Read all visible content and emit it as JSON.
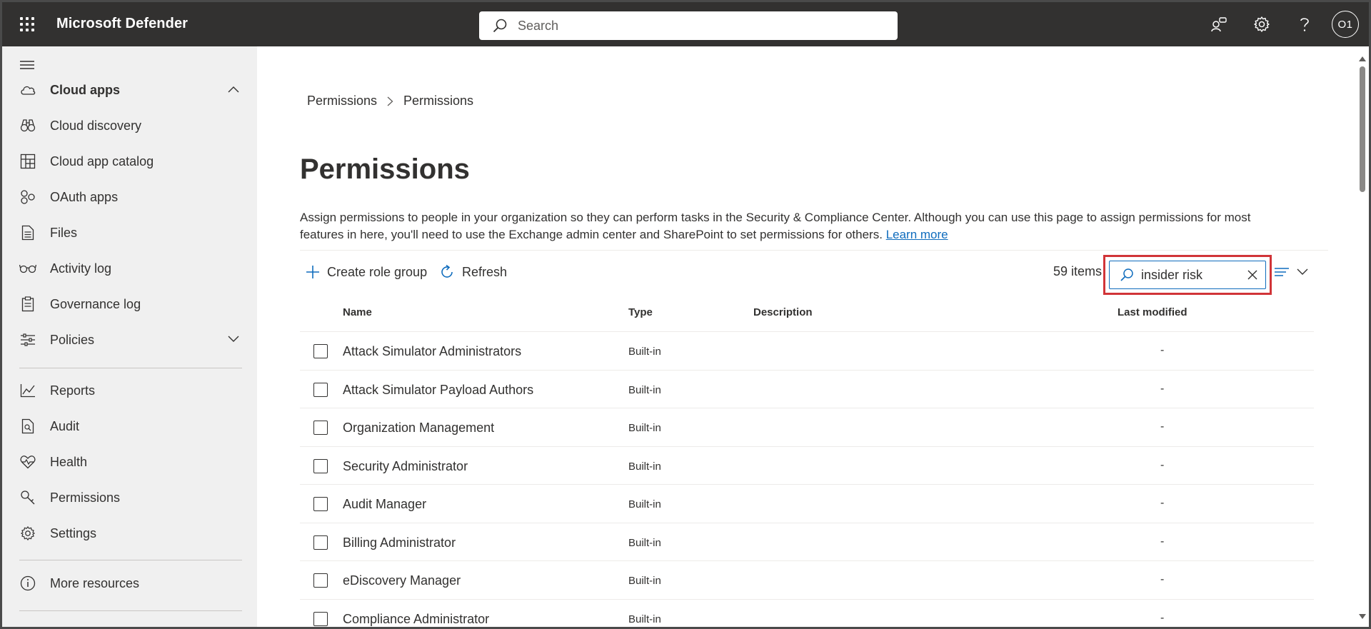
{
  "topbar": {
    "app_title": "Microsoft Defender",
    "search_placeholder": "Search",
    "avatar_initials": "O1"
  },
  "sidebar": {
    "items": [
      {
        "label": "Cloud apps",
        "icon": "cloud-icon",
        "bold": true,
        "chevron": "up"
      },
      {
        "label": "Cloud discovery",
        "icon": "binoculars-icon"
      },
      {
        "label": "Cloud app catalog",
        "icon": "catalog-icon"
      },
      {
        "label": "OAuth apps",
        "icon": "oauth-icon"
      },
      {
        "label": "Files",
        "icon": "file-icon"
      },
      {
        "label": "Activity log",
        "icon": "glasses-icon"
      },
      {
        "label": "Governance log",
        "icon": "clipboard-icon"
      },
      {
        "label": "Policies",
        "icon": "sliders-icon",
        "chevron": "down"
      },
      {
        "label": "Reports",
        "icon": "chart-icon"
      },
      {
        "label": "Audit",
        "icon": "audit-icon"
      },
      {
        "label": "Health",
        "icon": "heart-icon"
      },
      {
        "label": "Permissions",
        "icon": "key-icon"
      },
      {
        "label": "Settings",
        "icon": "gear-icon"
      },
      {
        "label": "More resources",
        "icon": "info-icon"
      }
    ]
  },
  "breadcrumb": [
    "Permissions",
    "Permissions"
  ],
  "page": {
    "title": "Permissions",
    "description": "Assign permissions to people in your organization so they can perform tasks in the Security & Compliance Center. Although you can use this page to assign permissions for most features in here, you'll need to use the Exchange admin center and SharePoint to set permissions for others.",
    "learn_more": "Learn more"
  },
  "toolbar": {
    "create_label": "Create role group",
    "refresh_label": "Refresh",
    "items_count": "59 items",
    "filter_value": "insider risk"
  },
  "table": {
    "columns": [
      "Name",
      "Type",
      "Description",
      "Last modified"
    ],
    "rows": [
      {
        "name": "Attack Simulator Administrators",
        "type": "Built-in",
        "description": "",
        "last_modified": "-"
      },
      {
        "name": "Attack Simulator Payload Authors",
        "type": "Built-in",
        "description": "",
        "last_modified": "-"
      },
      {
        "name": "Organization Management",
        "type": "Built-in",
        "description": "",
        "last_modified": "-"
      },
      {
        "name": "Security Administrator",
        "type": "Built-in",
        "description": "",
        "last_modified": "-"
      },
      {
        "name": "Audit Manager",
        "type": "Built-in",
        "description": "",
        "last_modified": "-"
      },
      {
        "name": "Billing Administrator",
        "type": "Built-in",
        "description": "",
        "last_modified": "-"
      },
      {
        "name": "eDiscovery Manager",
        "type": "Built-in",
        "description": "",
        "last_modified": "-"
      },
      {
        "name": "Compliance Administrator",
        "type": "Built-in",
        "description": "",
        "last_modified": "-"
      }
    ]
  },
  "colors": {
    "topbar_bg": "#323130",
    "sidebar_bg": "#f0f0f0",
    "link": "#0f6cbd",
    "highlight_border": "#d13438"
  }
}
